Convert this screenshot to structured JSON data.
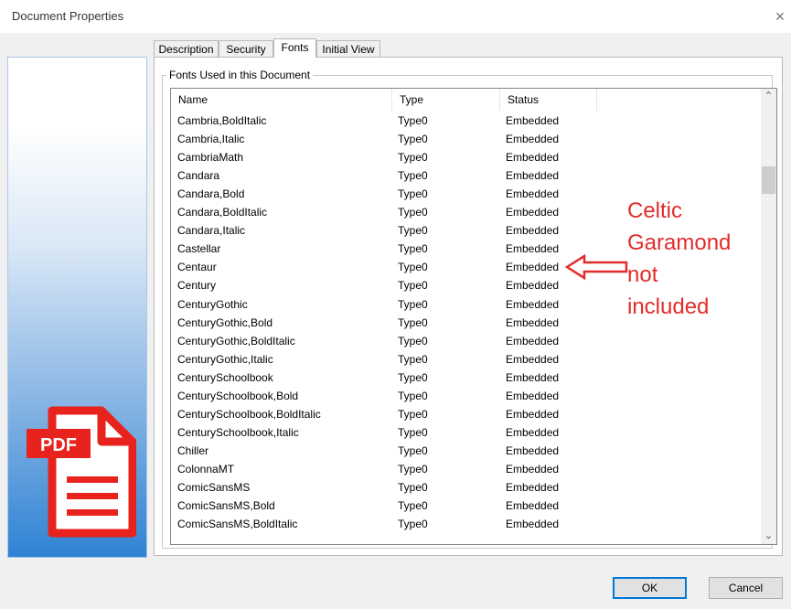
{
  "window": {
    "title": "Document Properties",
    "close_glyph": "×"
  },
  "tabs": [
    {
      "label": "Description",
      "active": false
    },
    {
      "label": "Security",
      "active": false
    },
    {
      "label": "Fonts",
      "active": true
    },
    {
      "label": "Initial View",
      "active": false
    }
  ],
  "group": {
    "legend": "Fonts Used in this Document"
  },
  "columns": [
    "Name",
    "Type",
    "Status"
  ],
  "fonts": [
    {
      "name": "Cambria,BoldItalic",
      "type": "Type0",
      "status": "Embedded"
    },
    {
      "name": "Cambria,Italic",
      "type": "Type0",
      "status": "Embedded"
    },
    {
      "name": "CambriaMath",
      "type": "Type0",
      "status": "Embedded"
    },
    {
      "name": "Candara",
      "type": "Type0",
      "status": "Embedded"
    },
    {
      "name": "Candara,Bold",
      "type": "Type0",
      "status": "Embedded"
    },
    {
      "name": "Candara,BoldItalic",
      "type": "Type0",
      "status": "Embedded"
    },
    {
      "name": "Candara,Italic",
      "type": "Type0",
      "status": "Embedded"
    },
    {
      "name": "Castellar",
      "type": "Type0",
      "status": "Embedded"
    },
    {
      "name": "Centaur",
      "type": "Type0",
      "status": "Embedded"
    },
    {
      "name": "Century",
      "type": "Type0",
      "status": "Embedded"
    },
    {
      "name": "CenturyGothic",
      "type": "Type0",
      "status": "Embedded"
    },
    {
      "name": "CenturyGothic,Bold",
      "type": "Type0",
      "status": "Embedded"
    },
    {
      "name": "CenturyGothic,BoldItalic",
      "type": "Type0",
      "status": "Embedded"
    },
    {
      "name": "CenturyGothic,Italic",
      "type": "Type0",
      "status": "Embedded"
    },
    {
      "name": "CenturySchoolbook",
      "type": "Type0",
      "status": "Embedded"
    },
    {
      "name": "CenturySchoolbook,Bold",
      "type": "Type0",
      "status": "Embedded"
    },
    {
      "name": "CenturySchoolbook,BoldItalic",
      "type": "Type0",
      "status": "Embedded"
    },
    {
      "name": "CenturySchoolbook,Italic",
      "type": "Type0",
      "status": "Embedded"
    },
    {
      "name": "Chiller",
      "type": "Type0",
      "status": "Embedded"
    },
    {
      "name": "ColonnaMT",
      "type": "Type0",
      "status": "Embedded"
    },
    {
      "name": "ComicSansMS",
      "type": "Type0",
      "status": "Embedded"
    },
    {
      "name": "ComicSansMS,Bold",
      "type": "Type0",
      "status": "Embedded"
    },
    {
      "name": "ComicSansMS,BoldItalic",
      "type": "Type0",
      "status": "Embedded"
    }
  ],
  "scrollbar": {
    "up_icon": "chevron-up-icon",
    "down_icon": "chevron-down-icon"
  },
  "annotation": {
    "lines": [
      "Celtic",
      "Garamond",
      "not",
      "included"
    ],
    "color": "#e32b2b",
    "arrow_icon": "left-arrow-outline-icon"
  },
  "pdf_logo": {
    "label": "PDF",
    "color": "#e8231d"
  },
  "buttons": {
    "ok": "OK",
    "cancel": "Cancel"
  }
}
